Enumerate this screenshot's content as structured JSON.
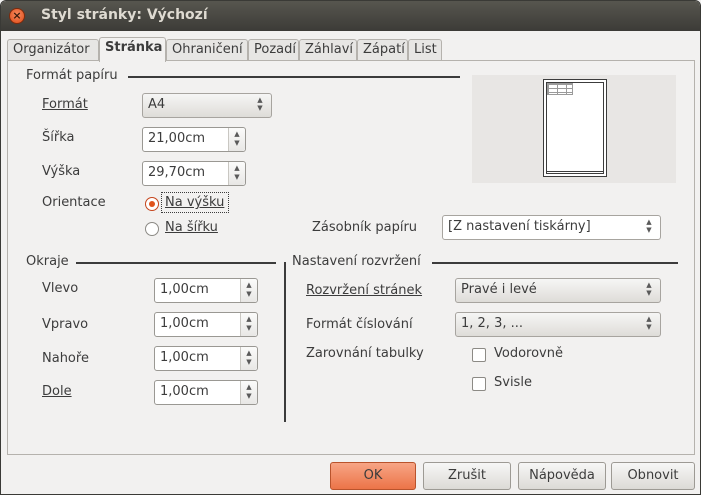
{
  "window": {
    "title": "Styl stránky: Výchozí"
  },
  "tabs": [
    "Organizátor",
    "Stránka",
    "Ohraničení",
    "Pozadí",
    "Záhlaví",
    "Zápatí",
    "List"
  ],
  "paper_format": {
    "section": "Formát papíru",
    "format_label": "Formát",
    "format_value": "A4",
    "width_label": "Šířka",
    "width_value": "21,00cm",
    "height_label": "Výška",
    "height_value": "29,70cm",
    "orientation_label": "Orientace",
    "portrait_label": "Na výšku",
    "landscape_label": "Na šířku",
    "orientation_selected": "portrait",
    "tray_label": "Zásobník papíru",
    "tray_value": "[Z nastavení tiskárny]"
  },
  "margins": {
    "section": "Okraje",
    "left_label": "Vlevo",
    "left_value": "1,00cm",
    "right_label": "Vpravo",
    "right_value": "1,00cm",
    "top_label": "Nahoře",
    "top_value": "1,00cm",
    "bottom_label": "Dole",
    "bottom_value": "1,00cm"
  },
  "layout": {
    "section": "Nastavení rozvržení",
    "page_layout_label": "Rozvržení stránek",
    "page_layout_value": "Pravé i levé",
    "numbering_label": "Formát číslování",
    "numbering_value": "1, 2, 3, ...",
    "table_alignment_label": "Zarovnání tabulky",
    "horizontal_label": "Vodorovně",
    "vertical_label": "Svisle",
    "horizontal_checked": false,
    "vertical_checked": false
  },
  "buttons": {
    "ok": "OK",
    "cancel": "Zrušit",
    "help": "Nápověda",
    "reset": "Obnovit"
  },
  "colors": {
    "accent": "#e0531c",
    "titlebar": "#3c3b37"
  }
}
